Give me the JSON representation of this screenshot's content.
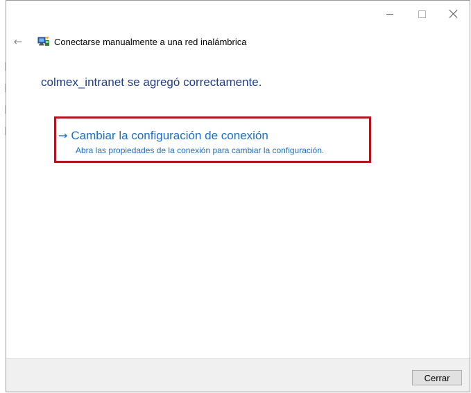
{
  "window": {
    "title": "Conectarse manualmente a una red inalámbrica",
    "controls": {
      "minimize_icon": "minimize-icon",
      "maximize_icon": "maximize-icon",
      "close_icon": "close-icon"
    }
  },
  "navigation": {
    "back_icon": "back-arrow-icon",
    "network_icon": "network-icon"
  },
  "content": {
    "success_message": "colmex_intranet se agregó correctamente.",
    "link": {
      "arrow": "→",
      "title": "Cambiar la configuración de conexión",
      "description": "Abra las propiedades de la conexión para cambiar la configuración."
    }
  },
  "footer": {
    "close_label": "Cerrar"
  },
  "colors": {
    "accent": "#1a6fc6",
    "heading": "#1f3d8c",
    "highlight_border": "#b3151f"
  }
}
